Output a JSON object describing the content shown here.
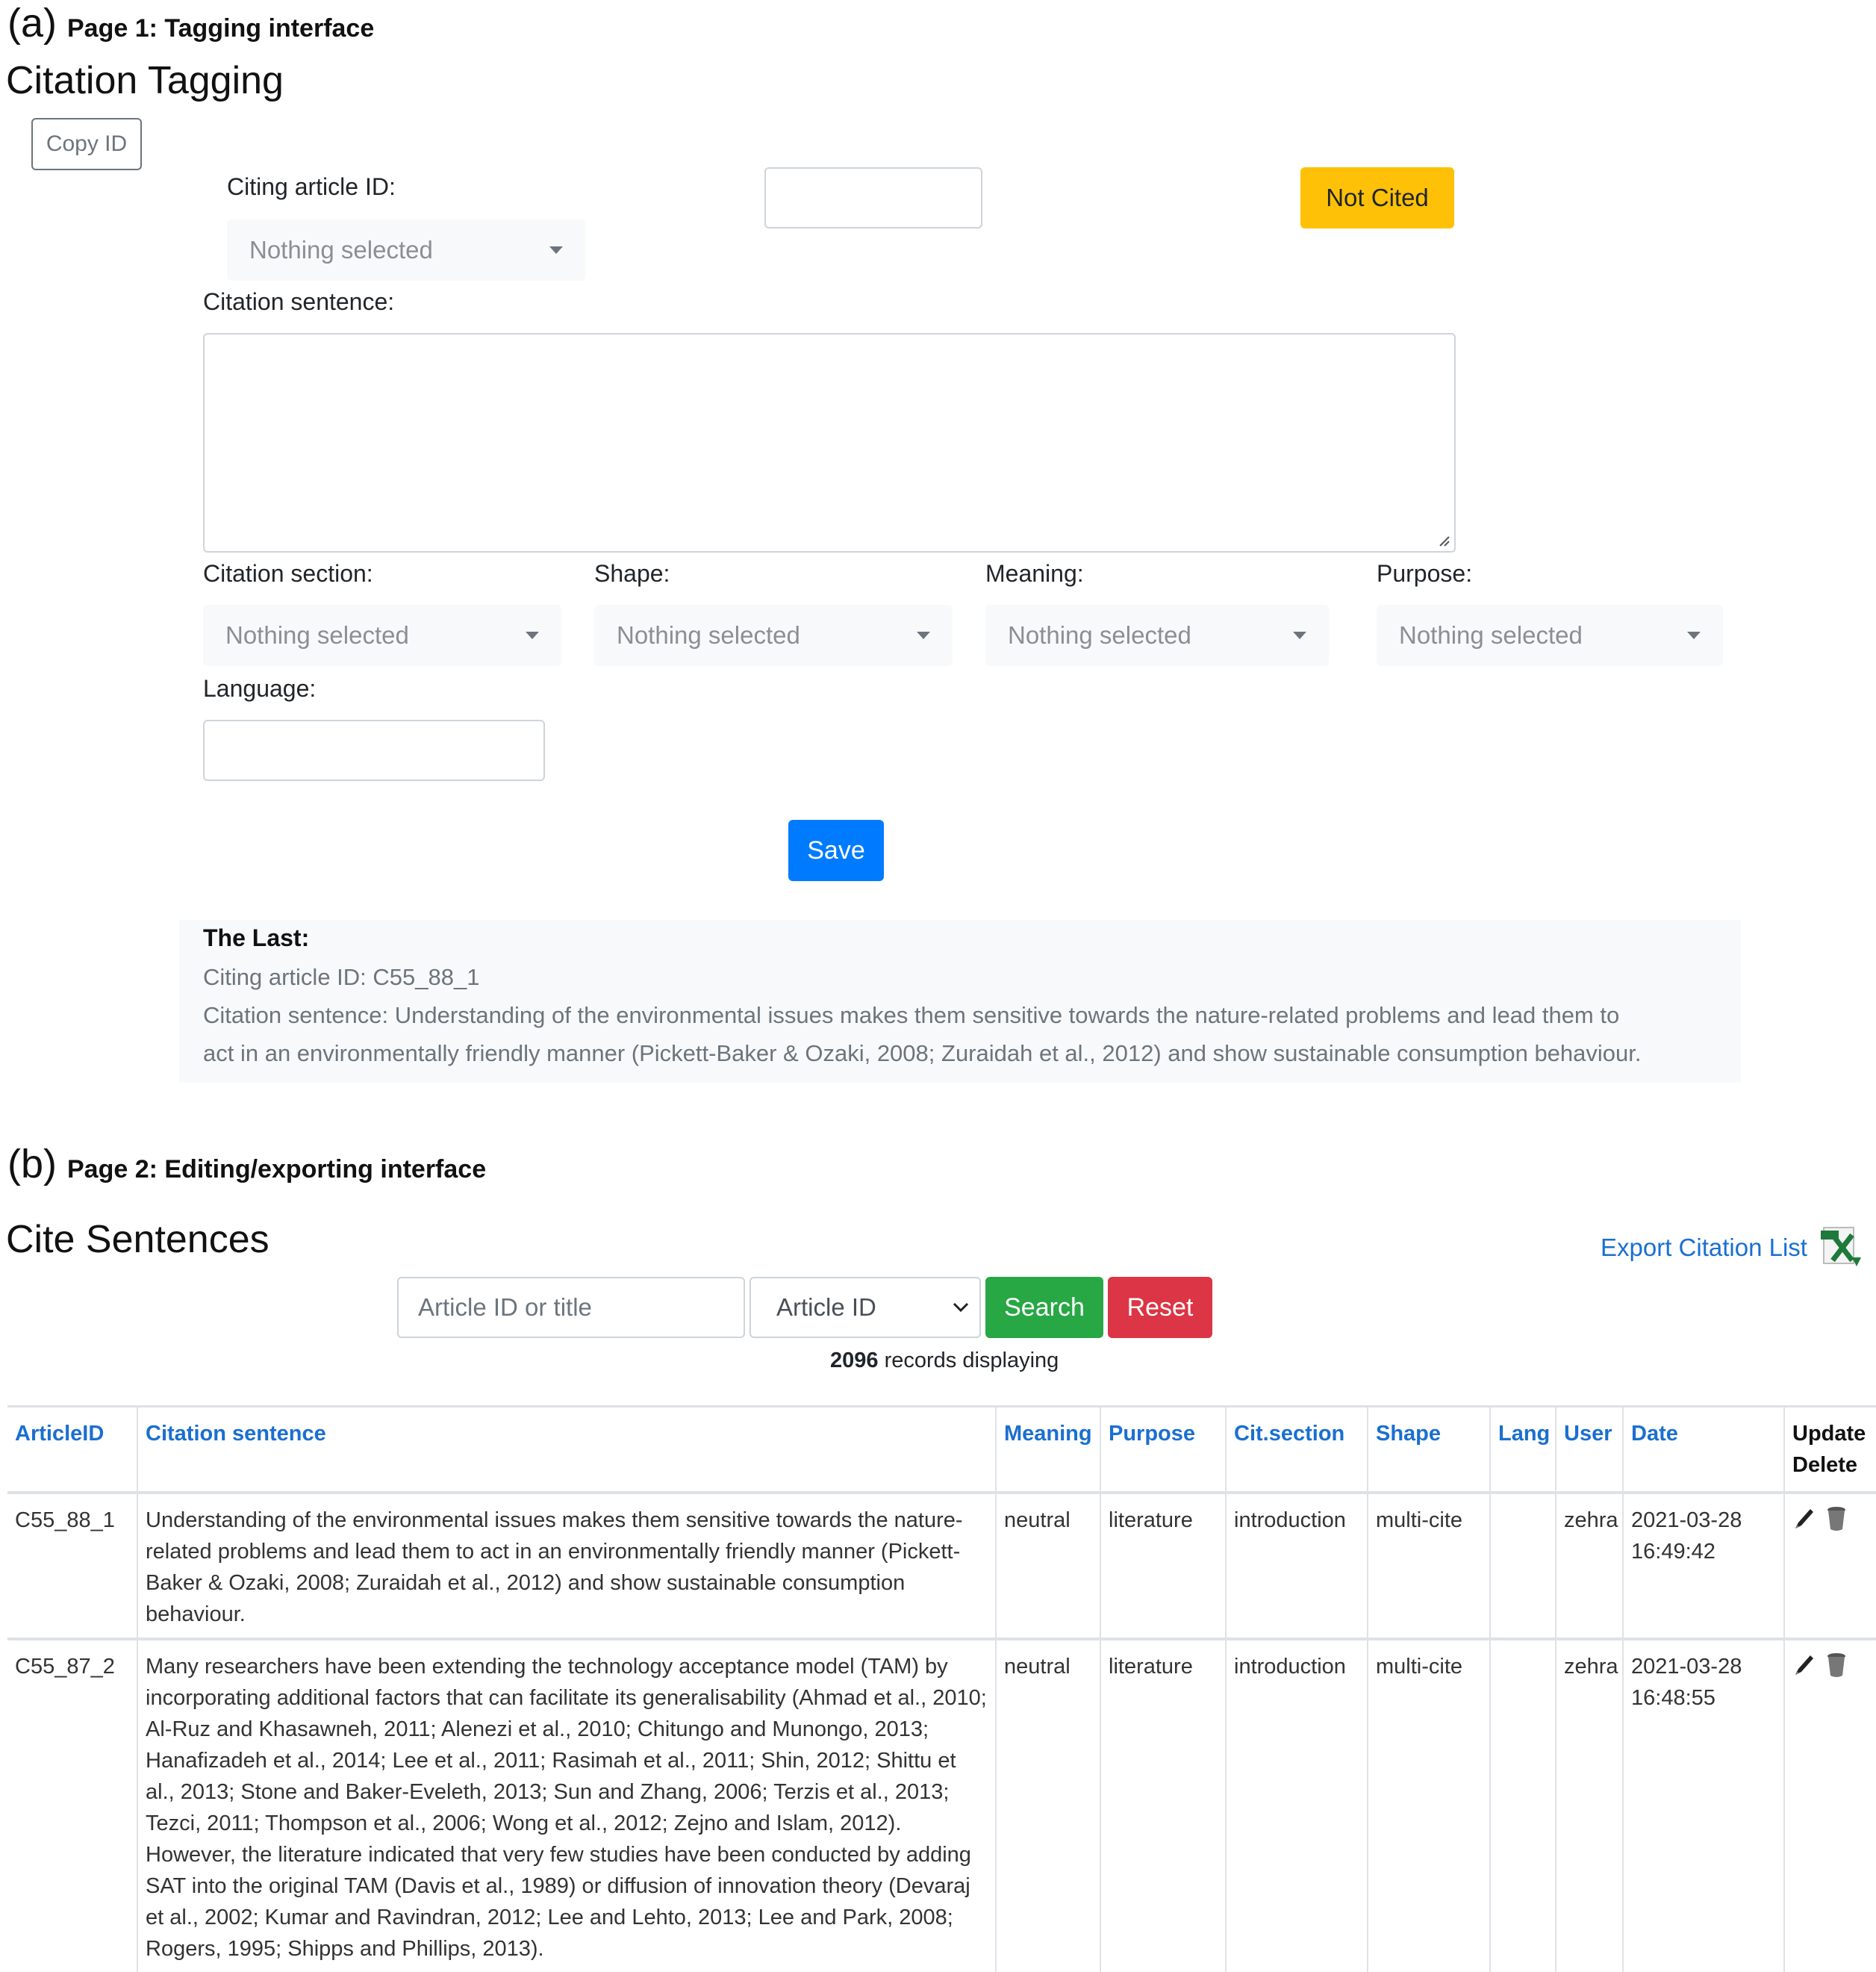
{
  "page1": {
    "caption_letter": "(a)",
    "caption_text": "Page 1: Tagging interface",
    "title": "Citation Tagging",
    "copy_id_label": "Copy ID",
    "citing_article_label": "Citing article ID:",
    "citing_article_picker": "Nothing selected",
    "article_id_input_value": "",
    "not_cited_label": "Not Cited",
    "citation_sentence_label": "Citation sentence:",
    "citation_sentence_value": "",
    "fields": [
      {
        "label": "Citation section:",
        "value": "Nothing selected"
      },
      {
        "label": "Shape:",
        "value": "Nothing selected"
      },
      {
        "label": "Meaning:",
        "value": "Nothing selected"
      },
      {
        "label": "Purpose:",
        "value": "Nothing selected"
      }
    ],
    "language_label": "Language:",
    "language_value": "",
    "save_label": "Save",
    "last": {
      "title": "The Last:",
      "citing_id_label": "Citing article ID:",
      "citing_id_value": "C55_88_1",
      "sentence_label": "Citation sentence:",
      "sentence_line1": "Understanding of the environmental issues makes them sensitive towards the nature-related problems and lead them to",
      "sentence_line2": "act in an environmentally friendly manner (Pickett-Baker & Ozaki, 2008; Zuraidah et al., 2012) and show sustainable consumption behaviour."
    }
  },
  "page2": {
    "caption_letter": "(b)",
    "caption_text": "Page 2: Editing/exporting interface",
    "title": "Cite Sentences",
    "export_label": "Export Citation List",
    "export_icon": "excel-export-icon",
    "search_placeholder": "Article ID or title",
    "search_value": "",
    "search_by_selected": "Article ID",
    "search_label": "Search",
    "reset_label": "Reset",
    "records_count": "2096",
    "records_suffix": " records displaying",
    "table": {
      "headers": [
        "ArticleID",
        "Citation sentence",
        "Meaning",
        "Purpose",
        "Cit.section",
        "Shape",
        "Lang",
        "User",
        "Date",
        "Update",
        "Delete"
      ],
      "rows": [
        {
          "article_id": "C55_88_1",
          "sentence": "Understanding of the environmental issues makes them sensitive towards the nature-related problems and lead them to act in an environmentally friendly manner (Pickett-Baker & Ozaki, 2008; Zuraidah et al., 2012) and show sustainable consumption behaviour.",
          "meaning": "neutral",
          "purpose": "literature",
          "section": "introduction",
          "shape": "multi-cite",
          "lang": "",
          "user": "zehra",
          "date": "2021-03-28",
          "time": "16:49:42"
        },
        {
          "article_id": "C55_87_2",
          "sentence": "Many researchers have been extending the technology acceptance model (TAM) by incorporating additional factors that can facilitate its generalisability (Ahmad et al., 2010; Al-Ruz and Khasawneh, 2011; Alenezi et al., 2010; Chitungo and Munongo, 2013; Hanafizadeh et al., 2014; Lee et al., 2011; Rasimah et al., 2011; Shin, 2012; Shittu et al., 2013; Stone and Baker-Eveleth, 2013; Sun and Zhang, 2006; Terzis et al., 2013; Tezci, 2011; Thompson et al., 2006; Wong et al., 2012; Zejno and Islam, 2012). However, the literature indicated that very few studies have been conducted by adding SAT into the original TAM (Davis et al., 1989) or diffusion of innovation theory (Devaraj et al., 2002; Kumar and Ravindran, 2012; Lee and Lehto, 2013; Lee and Park, 2008; Rogers, 1995; Shipps and Phillips, 2013).",
          "meaning": "neutral",
          "purpose": "literature",
          "section": "introduction",
          "shape": "multi-cite",
          "lang": "",
          "user": "zehra",
          "date": "2021-03-28",
          "time": "16:48:55"
        }
      ]
    }
  },
  "colors": {
    "warning": "#ffc107",
    "primary": "#007bff",
    "success": "#28a745",
    "danger": "#dc3545",
    "link": "#1a6fd1"
  }
}
